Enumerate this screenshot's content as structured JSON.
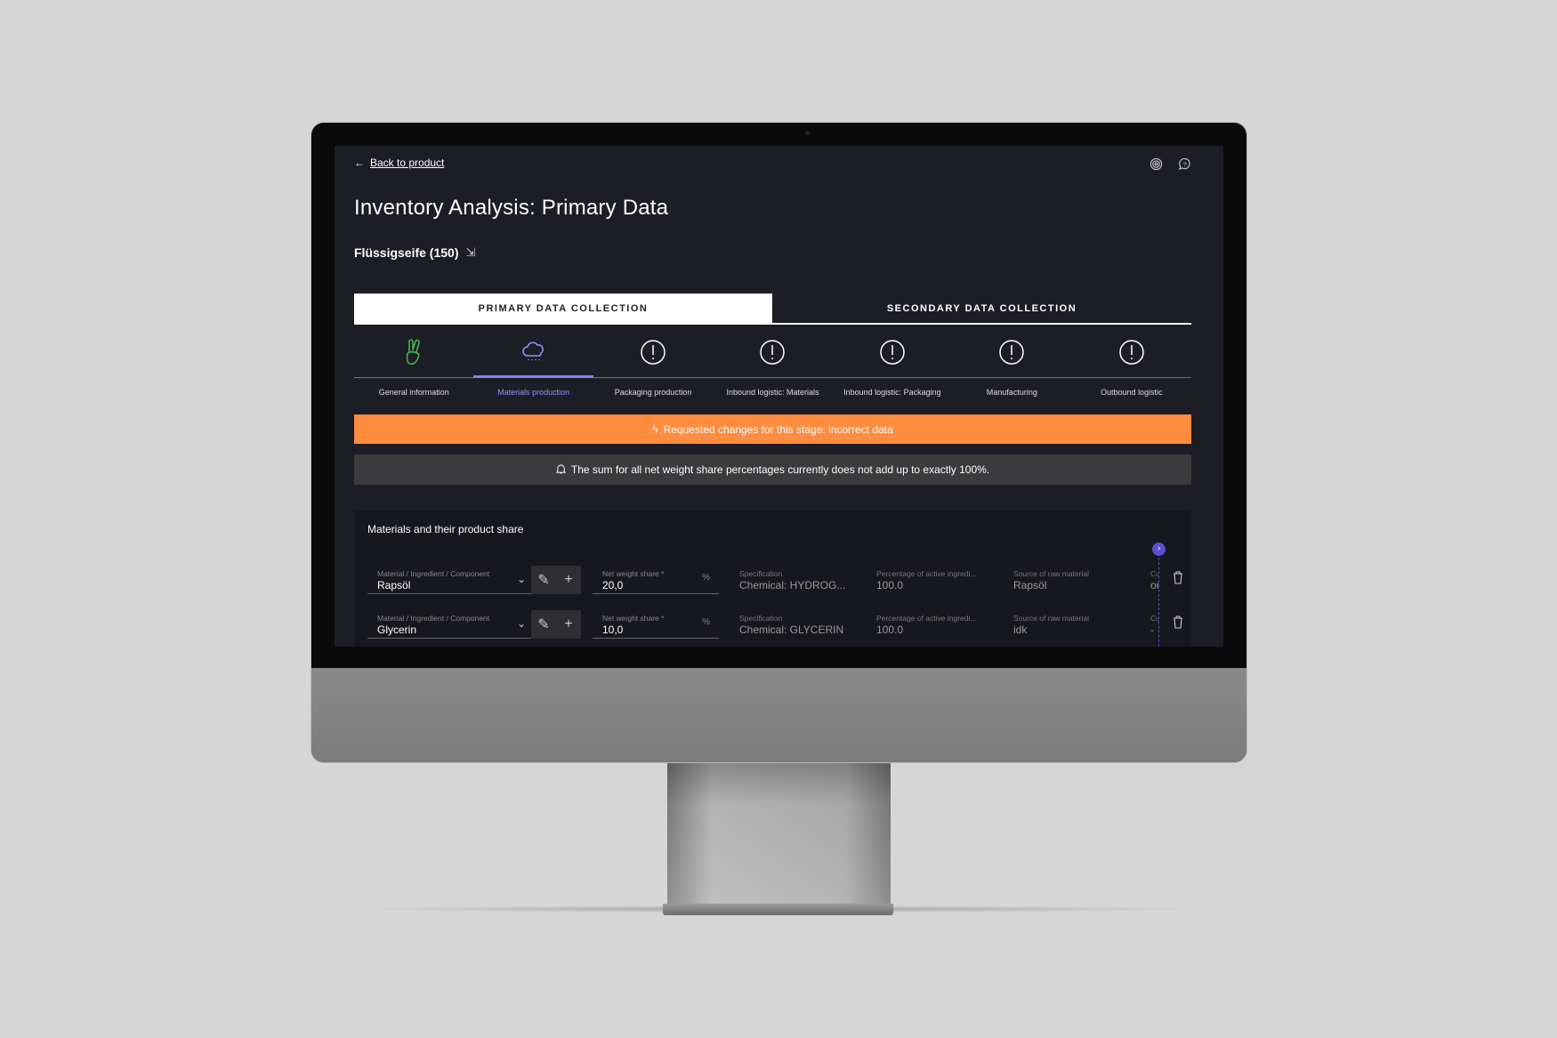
{
  "header": {
    "back_label": "Back to product",
    "title": "Inventory Analysis: Primary Data",
    "product": "Flüssigseife (150)"
  },
  "tabs": [
    {
      "label": "PRIMARY DATA COLLECTION",
      "active": true
    },
    {
      "label": "SECONDARY DATA COLLECTION",
      "active": false
    }
  ],
  "steps": [
    {
      "label": "General information",
      "icon": "peace-hand-icon",
      "status": "complete"
    },
    {
      "label": "Materials production",
      "icon": "cloud-rain-icon",
      "status": "active"
    },
    {
      "label": "Packaging production",
      "icon": "alert-circle-icon"
    },
    {
      "label": "Inbound logistic: Materials",
      "icon": "alert-circle-icon"
    },
    {
      "label": "Inbound logistic: Packaging",
      "icon": "alert-circle-icon"
    },
    {
      "label": "Manufacturing",
      "icon": "alert-circle-icon"
    },
    {
      "label": "Outbound logistic",
      "icon": "alert-circle-icon"
    }
  ],
  "alerts": {
    "requested": "Requested changes for this stage: incorrect data",
    "sum_warning": "The sum for all net weight share percentages currently does not add up to exactly 100%."
  },
  "materials": {
    "title": "Materials and their product share",
    "labels": {
      "material": "Material / Ingredient / Component",
      "net_weight": "Net weight share *",
      "unit": "%",
      "spec": "Specification",
      "pct_active": "Percentage of active ingredi...",
      "source": "Source of raw material",
      "cu": "Cu"
    },
    "rows": [
      {
        "material": "Rapsöl",
        "net_weight": "20,0",
        "spec": "Chemical: HYDROG...",
        "pct_active": "100.0",
        "source": "Rapsöl",
        "cu": "or"
      },
      {
        "material": "Glycerin",
        "net_weight": "10,0",
        "spec": "Chemical: GLYCERIN",
        "pct_active": "100.0",
        "source": "idk",
        "cu": "-"
      }
    ]
  },
  "colors": {
    "accent": "#8b7cf6",
    "warning": "#ff8c3f",
    "success": "#4caf50",
    "background": "#1d1d26"
  }
}
